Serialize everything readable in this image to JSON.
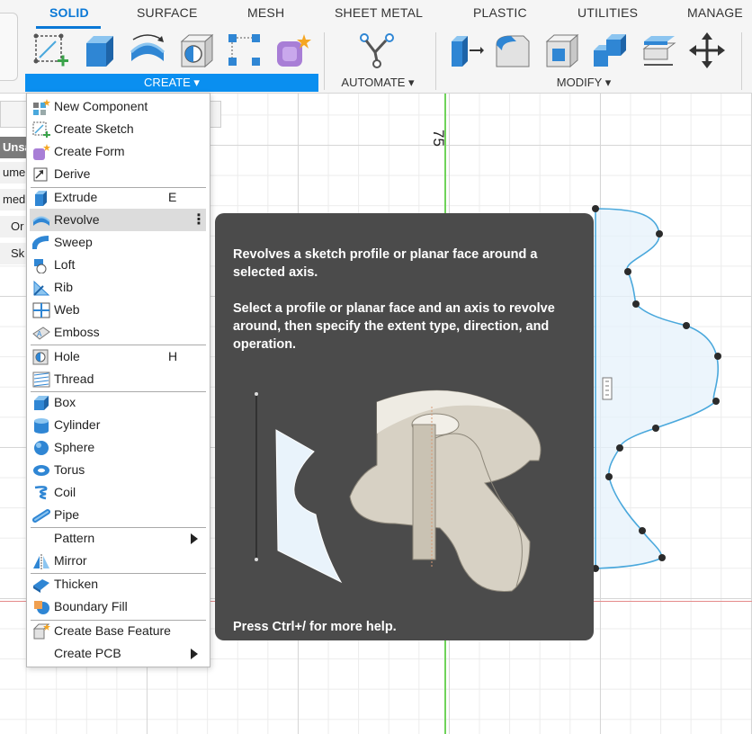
{
  "ribbon": {
    "tabs": [
      "SOLID",
      "SURFACE",
      "MESH",
      "SHEET METAL",
      "PLASTIC",
      "UTILITIES",
      "MANAGE"
    ],
    "groups": {
      "create": "CREATE ▾",
      "automate": "AUTOMATE ▾",
      "modify": "MODIFY ▾"
    }
  },
  "browser": {
    "rows": [
      "Unsa",
      "ume",
      "med",
      "Or",
      "Sk"
    ]
  },
  "canvas": {
    "dimension_label": "75"
  },
  "menu": {
    "items": [
      {
        "label": "New Component",
        "shortcut": "",
        "icon": "new-component-icon"
      },
      {
        "label": "Create Sketch",
        "shortcut": "",
        "icon": "create-sketch-icon"
      },
      {
        "label": "Create Form",
        "shortcut": "",
        "icon": "create-form-icon"
      },
      {
        "label": "Derive",
        "shortcut": "",
        "icon": "derive-icon"
      },
      {
        "label": "Extrude",
        "shortcut": "E",
        "icon": "extrude-icon"
      },
      {
        "label": "Revolve",
        "shortcut": "",
        "icon": "revolve-icon"
      },
      {
        "label": "Sweep",
        "shortcut": "",
        "icon": "sweep-icon"
      },
      {
        "label": "Loft",
        "shortcut": "",
        "icon": "loft-icon"
      },
      {
        "label": "Rib",
        "shortcut": "",
        "icon": "rib-icon"
      },
      {
        "label": "Web",
        "shortcut": "",
        "icon": "web-icon"
      },
      {
        "label": "Emboss",
        "shortcut": "",
        "icon": "emboss-icon"
      },
      {
        "label": "Hole",
        "shortcut": "H",
        "icon": "hole-icon"
      },
      {
        "label": "Thread",
        "shortcut": "",
        "icon": "thread-icon"
      },
      {
        "label": "Box",
        "shortcut": "",
        "icon": "box-icon"
      },
      {
        "label": "Cylinder",
        "shortcut": "",
        "icon": "cylinder-icon"
      },
      {
        "label": "Sphere",
        "shortcut": "",
        "icon": "sphere-icon"
      },
      {
        "label": "Torus",
        "shortcut": "",
        "icon": "torus-icon"
      },
      {
        "label": "Coil",
        "shortcut": "",
        "icon": "coil-icon"
      },
      {
        "label": "Pipe",
        "shortcut": "",
        "icon": "pipe-icon"
      },
      {
        "label": "Pattern",
        "shortcut": "",
        "icon": ""
      },
      {
        "label": "Mirror",
        "shortcut": "",
        "icon": "mirror-icon"
      },
      {
        "label": "Thicken",
        "shortcut": "",
        "icon": "thicken-icon"
      },
      {
        "label": "Boundary Fill",
        "shortcut": "",
        "icon": "boundary-fill-icon"
      },
      {
        "label": "Create Base Feature",
        "shortcut": "",
        "icon": "base-feature-icon"
      },
      {
        "label": "Create PCB",
        "shortcut": "",
        "icon": ""
      }
    ],
    "more_glyph": "⋮"
  },
  "tooltip": {
    "summary": "Revolves a sketch profile or planar face around a selected axis.",
    "details": "Select a profile or planar face and an axis to revolve around, then specify the extent type, direction, and operation.",
    "footer": "Press Ctrl+/ for more help."
  },
  "colors": {
    "accent": "#0a8ff0",
    "tooltip_bg": "#4b4b4b",
    "menu_highlight": "#dcdcdc",
    "sketch_blue": "#4aa8dc"
  }
}
